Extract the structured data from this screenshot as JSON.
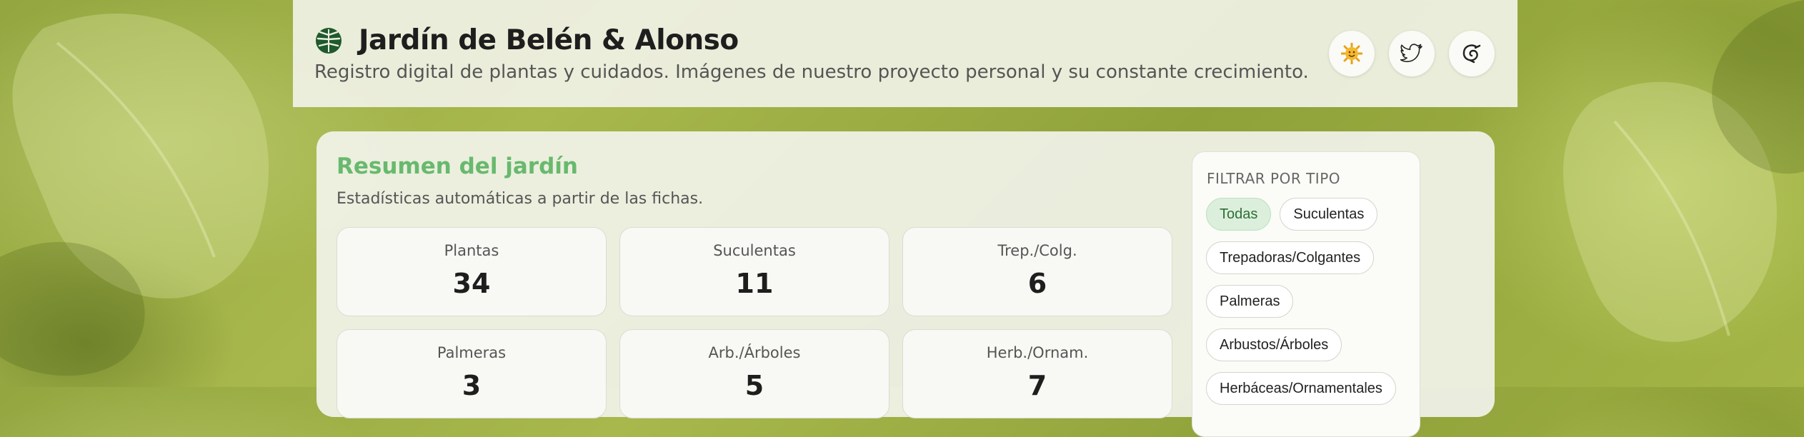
{
  "header": {
    "title": "Jardín de Belén & Alonso",
    "subtitle": "Registro digital de plantas y cuidados. Imágenes de nuestro proyecto personal y su constante crecimiento.",
    "social": [
      {
        "icon": "sun-face-icon"
      },
      {
        "icon": "twitter-bird-icon"
      },
      {
        "icon": "swirl-icon"
      }
    ]
  },
  "summary": {
    "title": "Resumen del jardín",
    "subtitle": "Estadísticas automáticas a partir de las fichas.",
    "stats": [
      {
        "label": "Plantas",
        "value": "34"
      },
      {
        "label": "Suculentas",
        "value": "11"
      },
      {
        "label": "Trep./Colg.",
        "value": "6"
      },
      {
        "label": "Palmeras",
        "value": "3"
      },
      {
        "label": "Arb./Árboles",
        "value": "5"
      },
      {
        "label": "Herb./Ornam.",
        "value": "7"
      }
    ]
  },
  "filter": {
    "title": "FILTRAR POR TIPO",
    "chips": [
      {
        "label": "Todas",
        "active": true
      },
      {
        "label": "Suculentas",
        "active": false
      },
      {
        "label": "Trepadoras/Colgantes",
        "active": false
      },
      {
        "label": "Palmeras",
        "active": false
      },
      {
        "label": "Arbustos/Árboles",
        "active": false
      },
      {
        "label": "Herbáceas/Ornamentales",
        "active": false
      }
    ]
  },
  "colors": {
    "accent_green": "#68b96e",
    "chip_active_bg": "#dcefdc",
    "background_green": "#a0b245"
  }
}
